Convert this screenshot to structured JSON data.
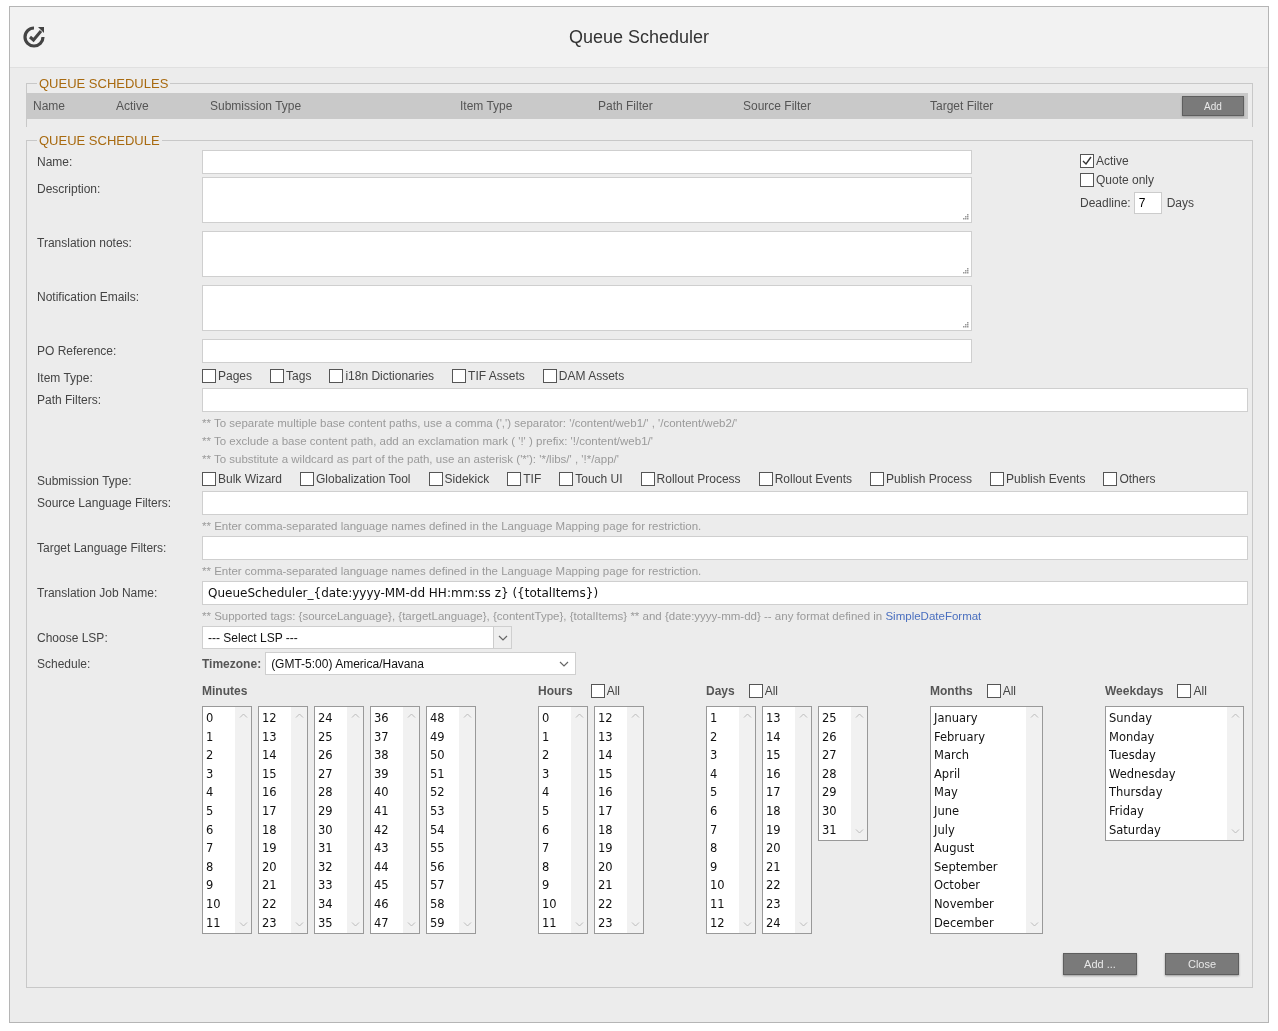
{
  "window": {
    "title": "Queue Scheduler"
  },
  "schedules": {
    "legend": "QUEUE SCHEDULES",
    "columns": [
      "Name",
      "Active",
      "Submission Type",
      "Item Type",
      "Path Filter",
      "Source Filter",
      "Target Filter"
    ],
    "add_button": "Add"
  },
  "schedule_form": {
    "legend": "QUEUE SCHEDULE",
    "upper_fields": [
      {
        "kind": "text",
        "label": "Name:"
      },
      {
        "kind": "textarea",
        "label": "Description:"
      },
      {
        "kind": "textarea",
        "label": "Translation notes:"
      },
      {
        "kind": "textarea",
        "label": "Notification Emails:"
      },
      {
        "kind": "text",
        "label": "PO Reference:"
      }
    ],
    "side": {
      "options": [
        {
          "label": "Active",
          "checked": true
        },
        {
          "label": "Quote only",
          "checked": false
        }
      ],
      "deadline": {
        "label": "Deadline:",
        "value": "7",
        "unit": "Days"
      }
    },
    "lower_fields": [
      {
        "kind": "checkboxes",
        "label": "Item Type:",
        "options": [
          {
            "label": "Pages",
            "checked": false
          },
          {
            "label": "Tags",
            "checked": false
          },
          {
            "label": "i18n Dictionaries",
            "checked": false
          },
          {
            "label": "TIF Assets",
            "checked": false
          },
          {
            "label": "DAM Assets",
            "checked": false
          }
        ]
      },
      {
        "kind": "text",
        "label": "Path Filters:",
        "hints": [
          "** To separate multiple base content paths, use a comma (',') separator: '/content/web1/' , '/content/web2/'",
          "** To exclude a base content path, add an exclamation mark ( '!' ) prefix: '!/content/web1/'",
          "** To substitute a wildcard as part of the path, use an asterisk ('*'): '*/libs/' , '!*/app/'"
        ]
      },
      {
        "kind": "checkboxes",
        "label": "Submission Type:",
        "options": [
          {
            "label": "Bulk Wizard",
            "checked": false
          },
          {
            "label": "Globalization Tool",
            "checked": false
          },
          {
            "label": "Sidekick",
            "checked": false
          },
          {
            "label": "TIF",
            "checked": false
          },
          {
            "label": "Touch UI",
            "checked": false
          },
          {
            "label": "Rollout Process",
            "checked": false
          },
          {
            "label": "Rollout Events",
            "checked": false
          },
          {
            "label": "Publish Process",
            "checked": false
          },
          {
            "label": "Publish Events",
            "checked": false
          },
          {
            "label": "Others",
            "checked": false
          }
        ]
      },
      {
        "kind": "text",
        "label": "Source Language Filters:",
        "hints": [
          "** Enter comma-separated language names defined in the Language Mapping page for restriction."
        ]
      },
      {
        "kind": "text",
        "label": "Target Language Filters:",
        "hints": [
          "** Enter comma-separated language names defined in the Language Mapping page for restriction."
        ]
      },
      {
        "kind": "text",
        "label": "Translation Job Name:",
        "value": "QueueScheduler_{date:yyyy-MM-dd HH:mm:ss z} ({totalItems})",
        "hints": [
          "** Supported tags: {sourceLanguage}, {targetLanguage}, {contentType}, {totalItems} ** and {date:yyyy-mm-dd} -- any format defined in"
        ],
        "hint_link": "SimpleDateFormat"
      },
      {
        "kind": "select",
        "label": "Choose LSP:",
        "value": "--- Select LSP ---"
      }
    ],
    "schedule": {
      "label": "Schedule:",
      "timezone_label": "Timezone:",
      "timezone": "(GMT-5:00) America/Havana",
      "groups": [
        {
          "kind": "minutes",
          "title": "Minutes",
          "lists": [
            [
              "0",
              "1",
              "2",
              "3",
              "4",
              "5",
              "6",
              "7",
              "8",
              "9",
              "10",
              "11"
            ],
            [
              "12",
              "13",
              "14",
              "15",
              "16",
              "17",
              "18",
              "19",
              "20",
              "21",
              "22",
              "23"
            ],
            [
              "24",
              "25",
              "26",
              "27",
              "28",
              "29",
              "30",
              "31",
              "32",
              "33",
              "34",
              "35"
            ],
            [
              "36",
              "37",
              "38",
              "39",
              "40",
              "41",
              "42",
              "43",
              "44",
              "45",
              "46",
              "47"
            ],
            [
              "48",
              "49",
              "50",
              "51",
              "52",
              "53",
              "54",
              "55",
              "56",
              "57",
              "58",
              "59"
            ]
          ]
        },
        {
          "kind": "hours",
          "title": "Hours",
          "all": {
            "label": "All",
            "checked": false
          },
          "lists": [
            [
              "0",
              "1",
              "2",
              "3",
              "4",
              "5",
              "6",
              "7",
              "8",
              "9",
              "10",
              "11"
            ],
            [
              "12",
              "13",
              "14",
              "15",
              "16",
              "17",
              "18",
              "19",
              "20",
              "21",
              "22",
              "23"
            ]
          ]
        },
        {
          "kind": "days",
          "title": "Days",
          "all": {
            "label": "All",
            "checked": false
          },
          "lists": [
            [
              "1",
              "2",
              "3",
              "4",
              "5",
              "6",
              "7",
              "8",
              "9",
              "10",
              "11",
              "12"
            ],
            [
              "13",
              "14",
              "15",
              "16",
              "17",
              "18",
              "19",
              "20",
              "21",
              "22",
              "23",
              "24"
            ],
            [
              "25",
              "26",
              "27",
              "28",
              "29",
              "30",
              "31"
            ]
          ]
        },
        {
          "kind": "months",
          "title": "Months",
          "all": {
            "label": "All",
            "checked": false
          },
          "lists": [
            [
              "January",
              "February",
              "March",
              "April",
              "May",
              "June",
              "July",
              "August",
              "September",
              "October",
              "November",
              "December"
            ]
          ]
        },
        {
          "kind": "weekdays",
          "title": "Weekdays",
          "all": {
            "label": "All",
            "checked": false
          },
          "lists": [
            [
              "Sunday",
              "Monday",
              "Tuesday",
              "Wednesday",
              "Thursday",
              "Friday",
              "Saturday"
            ]
          ]
        }
      ]
    }
  },
  "buttons": [
    "Add ...",
    "Close"
  ]
}
